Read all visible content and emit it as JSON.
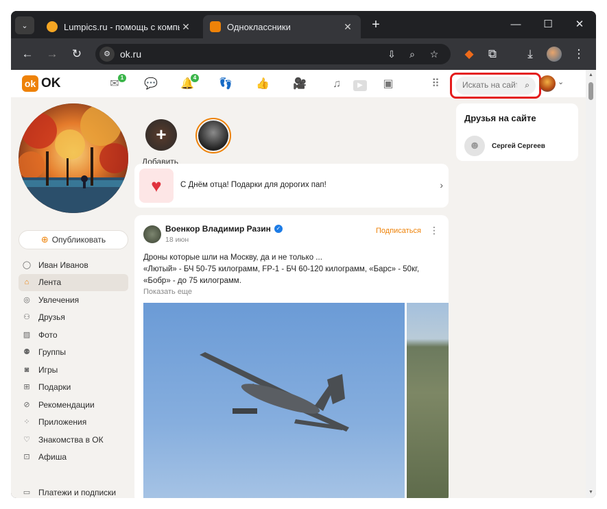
{
  "browser": {
    "tabs": [
      {
        "title": "Lumpics.ru - помощь с компью",
        "favicon_color": "#f5a623",
        "active": false
      },
      {
        "title": "Одноклассники",
        "favicon_color": "#ee8208",
        "active": true
      }
    ],
    "url": "ok.ru",
    "icons": {
      "tab_menu": "chevron-down-icon",
      "new_tab": "plus-icon",
      "minimize": "minimize-icon",
      "maximize": "maximize-icon",
      "close": "close-icon",
      "back": "back-arrow-icon",
      "forward": "forward-arrow-icon",
      "reload": "reload-icon",
      "site_info": "tune-icon",
      "install": "install-app-icon",
      "zoom": "zoom-icon",
      "bookmark": "star-icon",
      "extension": "fox-extension-icon",
      "extensions": "puzzle-icon",
      "downloads": "download-icon",
      "more": "kebab-menu-icon"
    }
  },
  "ok": {
    "logo_text": "OK",
    "nav": [
      {
        "name": "messages",
        "icon": "mail-icon",
        "badge": "1"
      },
      {
        "name": "discussions",
        "icon": "chat-icon",
        "badge": ""
      },
      {
        "name": "notifications",
        "icon": "bell-icon",
        "badge": "4"
      },
      {
        "name": "guests",
        "icon": "footprints-icon",
        "badge": ""
      },
      {
        "name": "marks",
        "icon": "thumbs-up-icon",
        "badge": ""
      },
      {
        "name": "video-call",
        "icon": "video-camera-icon",
        "badge": ""
      },
      {
        "name": "music",
        "icon": "music-note-icon",
        "badge": ""
      },
      {
        "name": "video",
        "icon": "play-icon",
        "badge": ""
      },
      {
        "name": "calendar",
        "icon": "calendar-icon",
        "badge": ""
      },
      {
        "name": "apps",
        "icon": "apps-grid-icon",
        "badge": ""
      }
    ],
    "search_placeholder": "Искать на сайте",
    "highlight_color": "#e41b1b",
    "accent_color": "#ee8208"
  },
  "sidebar": {
    "publish_label": "Опубликовать",
    "items": [
      {
        "label": "Иван Иванов",
        "icon": "user-icon",
        "active": false
      },
      {
        "label": "Лента",
        "icon": "home-icon",
        "active": true
      },
      {
        "label": "Увлечения",
        "icon": "hobby-icon",
        "active": false
      },
      {
        "label": "Друзья",
        "icon": "friends-icon",
        "active": false
      },
      {
        "label": "Фото",
        "icon": "photo-icon",
        "active": false
      },
      {
        "label": "Группы",
        "icon": "groups-icon",
        "active": false
      },
      {
        "label": "Игры",
        "icon": "gamepad-icon",
        "active": false
      },
      {
        "label": "Подарки",
        "icon": "gift-icon",
        "active": false
      },
      {
        "label": "Рекомендации",
        "icon": "compass-icon",
        "active": false
      },
      {
        "label": "Приложения",
        "icon": "apps-icon",
        "active": false
      },
      {
        "label": "Знакомства в ОК",
        "icon": "heart-icon",
        "active": false
      },
      {
        "label": "Афиша",
        "icon": "ticket-icon",
        "active": false
      }
    ],
    "bottom_items": [
      {
        "label": "Платежи и подписки",
        "icon": "wallet-icon"
      }
    ]
  },
  "stories": {
    "add_label": "Добавить"
  },
  "promo": {
    "text": "С Днём отца! Подарки для дорогих пап!"
  },
  "post": {
    "author": "Военкор Владимир Разин",
    "date": "18 июн",
    "subscribe_label": "Подписаться",
    "lines": [
      "Дроны которые шли на Москву, да и не только ...",
      "«Лютый» - БЧ 50-75 килограмм, FP-1 - БЧ 60-120 килограмм, «Барс» - 50кг,",
      "«Бобр» - до 75 килограмм."
    ],
    "show_more": "Показать еще"
  },
  "friends_online": {
    "title": "Друзья на сайте",
    "friends": [
      {
        "name": "Сергей Сергеев"
      }
    ]
  }
}
